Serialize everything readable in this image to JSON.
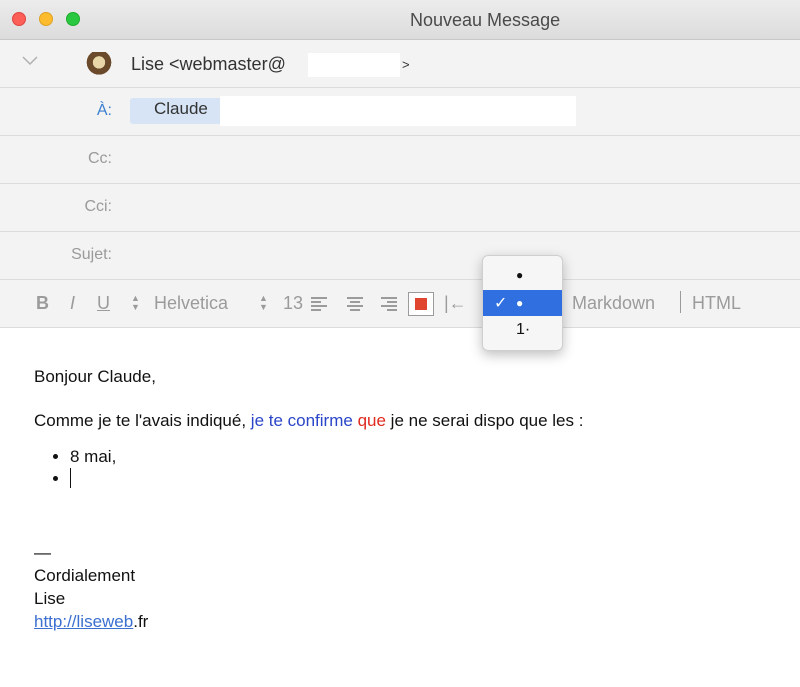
{
  "window": {
    "title": "Nouveau Message"
  },
  "header": {
    "from_text": "Lise <webmaster@",
    "from_tail": ">",
    "to_label": "À:",
    "to_name": "Claude",
    "cc_label": "Cc:",
    "bcc_label": "Cci:",
    "subject_label": "Sujet:"
  },
  "toolbar": {
    "bold": "B",
    "italic": "I",
    "underline": "U",
    "font": "Helvetica",
    "size": "13",
    "outdent": "|←",
    "markdown": "Markdown",
    "html": "HTML",
    "color_accent": "#e0462f"
  },
  "list_popup": {
    "items": [
      {
        "mark": "",
        "symbol": "●"
      },
      {
        "mark": "✓",
        "symbol": "●",
        "selected": true
      },
      {
        "mark": "",
        "symbol": "1·"
      }
    ]
  },
  "body": {
    "greeting": "Bonjour Claude,",
    "line_part1": "Comme je te l'avais indiqué, ",
    "line_blue": "je te confirme",
    "line_space": " ",
    "line_red": "que",
    "line_part2": " je ne serai dispo que les :",
    "bullet1": "8 mai,",
    "bullet2": ""
  },
  "signature": {
    "dash": "—",
    "closing": "Cordialement",
    "name": "Lise",
    "link_text": "http://liseweb",
    "link_tail": ".fr"
  }
}
